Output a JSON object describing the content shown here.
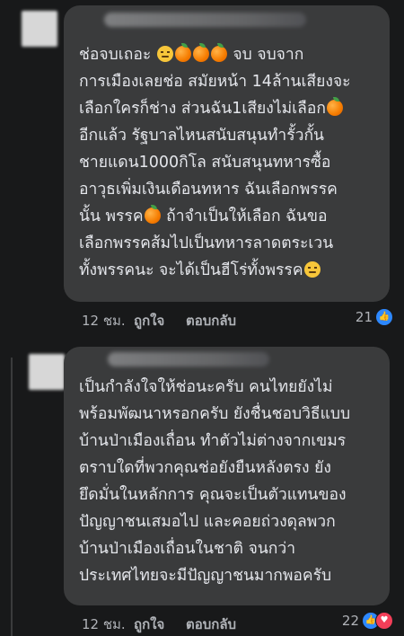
{
  "comments": [
    {
      "text": "ช่อจบเถอะ",
      "emoji_after_first": [
        "tired-face-icon",
        "orange-icon",
        "orange-icon",
        "orange-icon"
      ],
      "text_rest_1": " จบ จบจาก\nการเมืองเลยช่อ สมัยหน้า 14ล้านเสียงจะ\nเลือกใครก็ช่าง ส่วนฉัน1เสียงไม่เลือก",
      "text_rest_2": "\nอีกแล้ว รัฐบาลไหนสนับสนุนทำรั้วกั้น\nชายแดน1000กิโล สนับสนุนทหารซื้อ\nอาวุธเพิ่มเงินเดือนทหาร ฉันเลือกพรรค\nนั้น พรรค",
      "text_rest_3": " ถ้าจำเป็นให้เลือก ฉันขอ\nเลือกพรรคส้มไปเป็นทหารลาดตระเวน\nทั้งพรรคนะ จะได้เป็นฮีโร่ทั้งพรรค",
      "time": "12 ชม.",
      "like_label": "ถูกใจ",
      "reply_label": "ตอบกลับ",
      "reaction_count": "21",
      "reactions": [
        "like"
      ]
    },
    {
      "text": "เป็นกำลังใจให้ช่อนะครับ คนไทยยังไม่\nพร้อมพัฒนาหรอกครับ ยังชื่นชอบวิธีแบบ\nบ้านป่าเมืองเถื่อน ทำตัวไม่ต่างจากเขมร\nตราบใดที่พวกคุณช่อยังยืนหลังตรง ยัง\nยึดมั่นในหลักการ คุณจะเป็นตัวแทนของ\nปัญญาชนเสมอไป และคอยถ่วงดุลพวก\nบ้านป่าเมืองเถื่อนในชาติ จนกว่า\nประเทศไทยจะมีปัญญาชนมากพอครับ",
      "time": "12 ชม.",
      "like_label": "ถูกใจ",
      "reply_label": "ตอบกลับ",
      "reaction_count": "22",
      "reactions": [
        "like",
        "love"
      ]
    }
  ],
  "colors": {
    "background": "#18191a",
    "bubble": "#3a3b3c",
    "text": "#e4e6eb",
    "meta": "#b0b3b8",
    "like_blue": "#2d88ff",
    "love_red": "#f33e58"
  }
}
